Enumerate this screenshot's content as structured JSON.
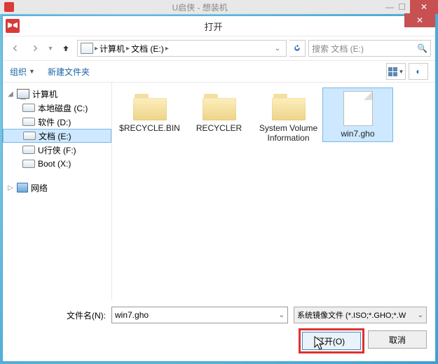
{
  "bg_title": "U启侠 - 想装机",
  "dialog": {
    "title": "打开"
  },
  "nav": {
    "crumb_root": "计算机",
    "crumb_loc": "文档 (E:)",
    "search_placeholder": "搜索 文档 (E:)"
  },
  "toolbar": {
    "organize": "组织",
    "new_folder": "新建文件夹"
  },
  "tree": {
    "root": "计算机",
    "items": [
      {
        "label": "本地磁盘 (C:)"
      },
      {
        "label": "软件 (D:)"
      },
      {
        "label": "文档 (E:)",
        "selected": true
      },
      {
        "label": "U行侠 (F:)"
      },
      {
        "label": "Boot (X:)"
      }
    ],
    "network": "网络"
  },
  "files": [
    {
      "name": "$RECYCLE.BIN",
      "type": "folder"
    },
    {
      "name": "RECYCLER",
      "type": "folder"
    },
    {
      "name": "System Volume Information",
      "type": "folder"
    },
    {
      "name": "win7.gho",
      "type": "file",
      "selected": true,
      "highlight": true
    }
  ],
  "footer": {
    "filename_label": "文件名(N):",
    "filename_value": "win7.gho",
    "filter": "系统镜像文件 (*.ISO;*.GHO;*.W",
    "open": "打开(O)",
    "cancel": "取消"
  }
}
